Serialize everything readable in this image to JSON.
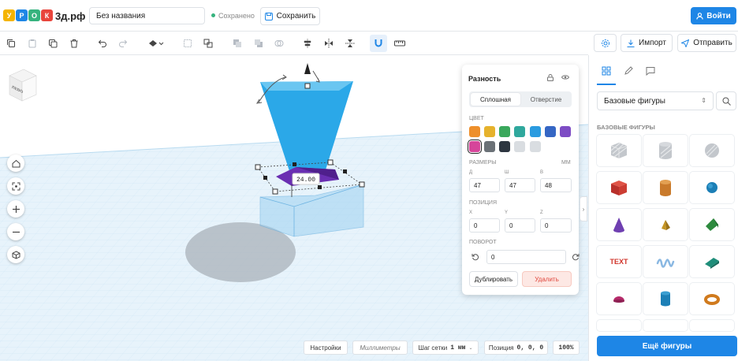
{
  "header": {
    "logo_letters": [
      "У",
      "Р",
      "О",
      "К"
    ],
    "logo_colors": [
      "#f4b400",
      "#1e86e6",
      "#36b37e",
      "#e8453c"
    ],
    "logo_domain": "3д.рф",
    "project_title": "Без названия",
    "saved_status": "Сохранено",
    "save_label": "Сохранить",
    "login_label": "Войти"
  },
  "toolbar": {
    "icons": [
      "copy-icon",
      "paste-icon",
      "duplicate-icon",
      "trash-icon",
      "undo-icon",
      "redo-icon",
      "visibility-icon",
      "group-icon",
      "ungroup-icon",
      "layer-icon",
      "align-icon",
      "mirror-icon",
      "flip-icon",
      "magnet-icon",
      "ruler-icon"
    ],
    "settings_icon": "gear-icon",
    "import_label": "Импорт",
    "send_label": "Отправить"
  },
  "viewport": {
    "view_cube_label": "ЛЕВО",
    "dimension_label": "24.00",
    "left_tools": [
      "home-icon",
      "fit-icon",
      "zoom-in-icon",
      "zoom-out-icon",
      "cube-icon"
    ]
  },
  "inspector": {
    "title": "Разность",
    "tab_solid": "Сплошная",
    "tab_hole": "Отверстие",
    "color_label": "ЦВЕТ",
    "colors": [
      "#e0473d",
      "#ee8f2b",
      "#e6b22c",
      "#3aa85c",
      "#2fa89d",
      "#2a9be0",
      "#3566c4",
      "#7d4cc4",
      "#d6459a",
      "#6b7177",
      "#2d3640",
      "#d9dde1"
    ],
    "selected_color_index": 7,
    "size_label": "РАЗМЕРЫ",
    "size_unit": "ММ",
    "size_sub": [
      "Д",
      "Ш",
      "В"
    ],
    "size_values": [
      "47",
      "47",
      "48"
    ],
    "position_label": "ПОЗИЦИЯ",
    "position_sub": [
      "X",
      "Y",
      "Z"
    ],
    "position_values": [
      "0",
      "0",
      "0"
    ],
    "rotation_label": "ПОВОРОТ",
    "rotation_value": "0",
    "duplicate_label": "Дублировать",
    "delete_label": "Удалить"
  },
  "statusbar": {
    "settings_label": "Настройки",
    "units_label": "Миллиметры",
    "grid_label": "Шаг сетки",
    "grid_value": "1 мм",
    "position_label": "Позиция",
    "position_value": "0, 0, 0",
    "zoom_value": "100%"
  },
  "sidebar": {
    "tabs": [
      "shapes-tab-icon",
      "pencil-icon",
      "comment-icon"
    ],
    "category_value": "Базовые фигуры",
    "section_title": "БАЗОВЫЕ ФИГУРЫ",
    "text_shape_label": "TEXT",
    "more_label": "Ещё фигуры"
  }
}
